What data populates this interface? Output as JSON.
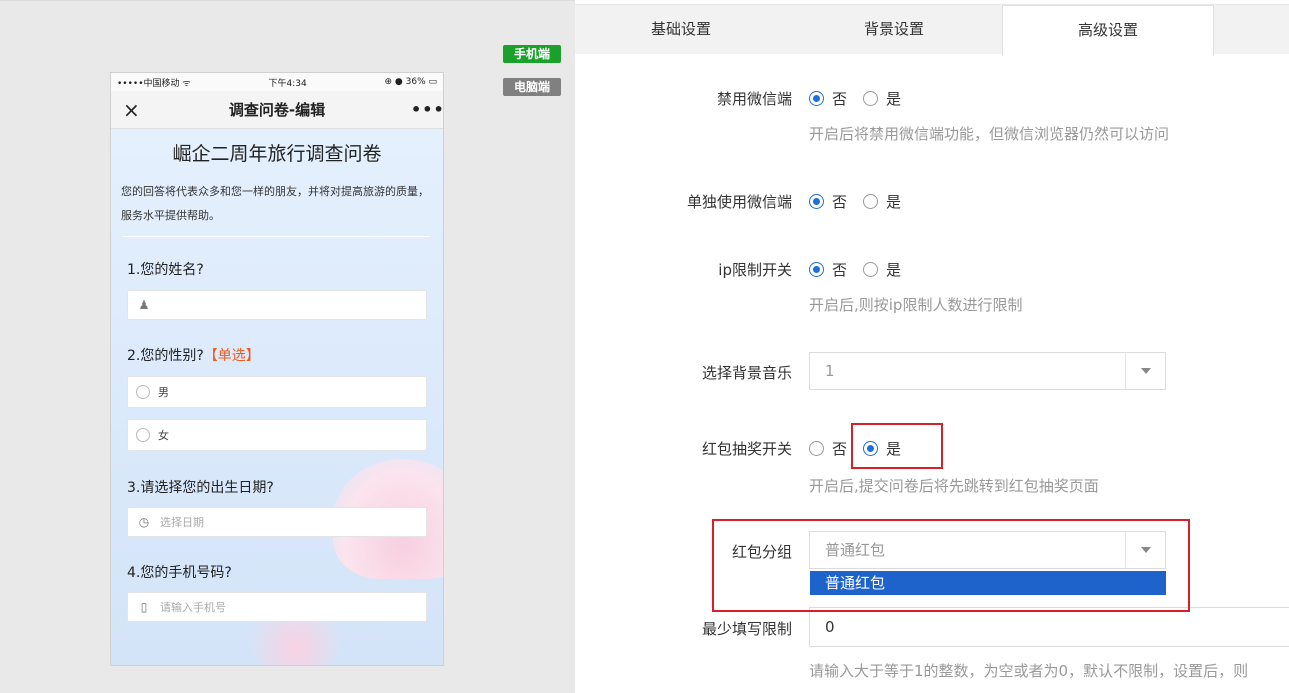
{
  "badges": {
    "mobile": "手机端",
    "pc": "电脑端"
  },
  "phone": {
    "status_left": "•••••中国移动 ᯤ",
    "status_time": "下午4:34",
    "status_right": "⊕ ● 36% ▭",
    "nav_close": "×",
    "nav_title": "调查问卷-编辑",
    "nav_more": "•••",
    "survey_title": "崛企二周年旅行调查问卷",
    "survey_desc": "您的回答将代表众多和您一样的朋友，并将对提高旅游的质量，服务水平提供帮助。",
    "q1": "1.您的姓名?",
    "q2": "2.您的性别?",
    "q2_tag": "【单选】",
    "q2_opt1": "男",
    "q2_opt2": "女",
    "q3": "3.请选择您的出生日期?",
    "q3_placeholder": "选择日期",
    "q4": "4.您的手机号码?",
    "q4_placeholder": "请输入手机号"
  },
  "tabs": [
    "基础设置",
    "背景设置",
    "高级设置"
  ],
  "settings": {
    "disable_wechat": {
      "label": "禁用微信端",
      "no": "否",
      "yes": "是",
      "hint": "开启后将禁用微信端功能，但微信浏览器仍然可以访问"
    },
    "solo_wechat": {
      "label": "单独使用微信端",
      "no": "否",
      "yes": "是"
    },
    "ip_limit": {
      "label": "ip限制开关",
      "no": "否",
      "yes": "是",
      "hint": "开启后,则按ip限制人数进行限制"
    },
    "bg_music": {
      "label": "选择背景音乐",
      "value": "1"
    },
    "redpacket": {
      "label": "红包抽奖开关",
      "no": "否",
      "yes": "是",
      "hint": "开启后,提交问卷后将先跳转到红包抽奖页面"
    },
    "redpacket_group": {
      "label": "红包分组",
      "value": "普通红包",
      "option": "普通红包"
    },
    "min_fill": {
      "label": "最少填写限制",
      "value": "0",
      "hint": "请输入大于等于1的整数，为空或者为0，默认不限制，设置后，则"
    }
  },
  "colors": {
    "accent": "#1e6fd9",
    "highlight": "#d8202a",
    "dropdown_selected": "#1e62cc"
  }
}
